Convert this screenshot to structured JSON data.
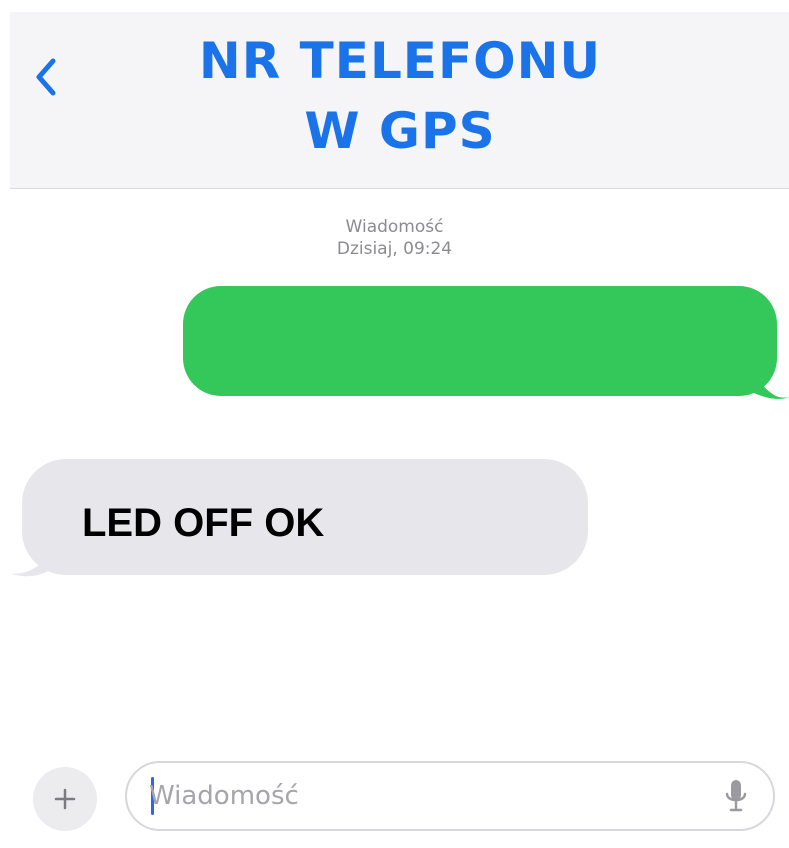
{
  "header": {
    "title_line1": "NR TELEFONU",
    "title_line2": "W GPS",
    "back_icon": "chevron-left-icon"
  },
  "conversation": {
    "timestamp_label": "Wiadomość",
    "timestamp_time": "Dzisiaj, 09:24",
    "outgoing": {
      "text": ""
    },
    "incoming": {
      "text": "LED OFF OK"
    }
  },
  "composer": {
    "plus_icon": "plus-icon",
    "placeholder": "Wiadomość",
    "value": "",
    "mic_icon": "microphone-icon"
  },
  "colors": {
    "accent": "#1a73e8",
    "outgoing_bubble": "#34c759",
    "incoming_bubble": "#e7e7eb",
    "caret": "#2a66f2"
  }
}
